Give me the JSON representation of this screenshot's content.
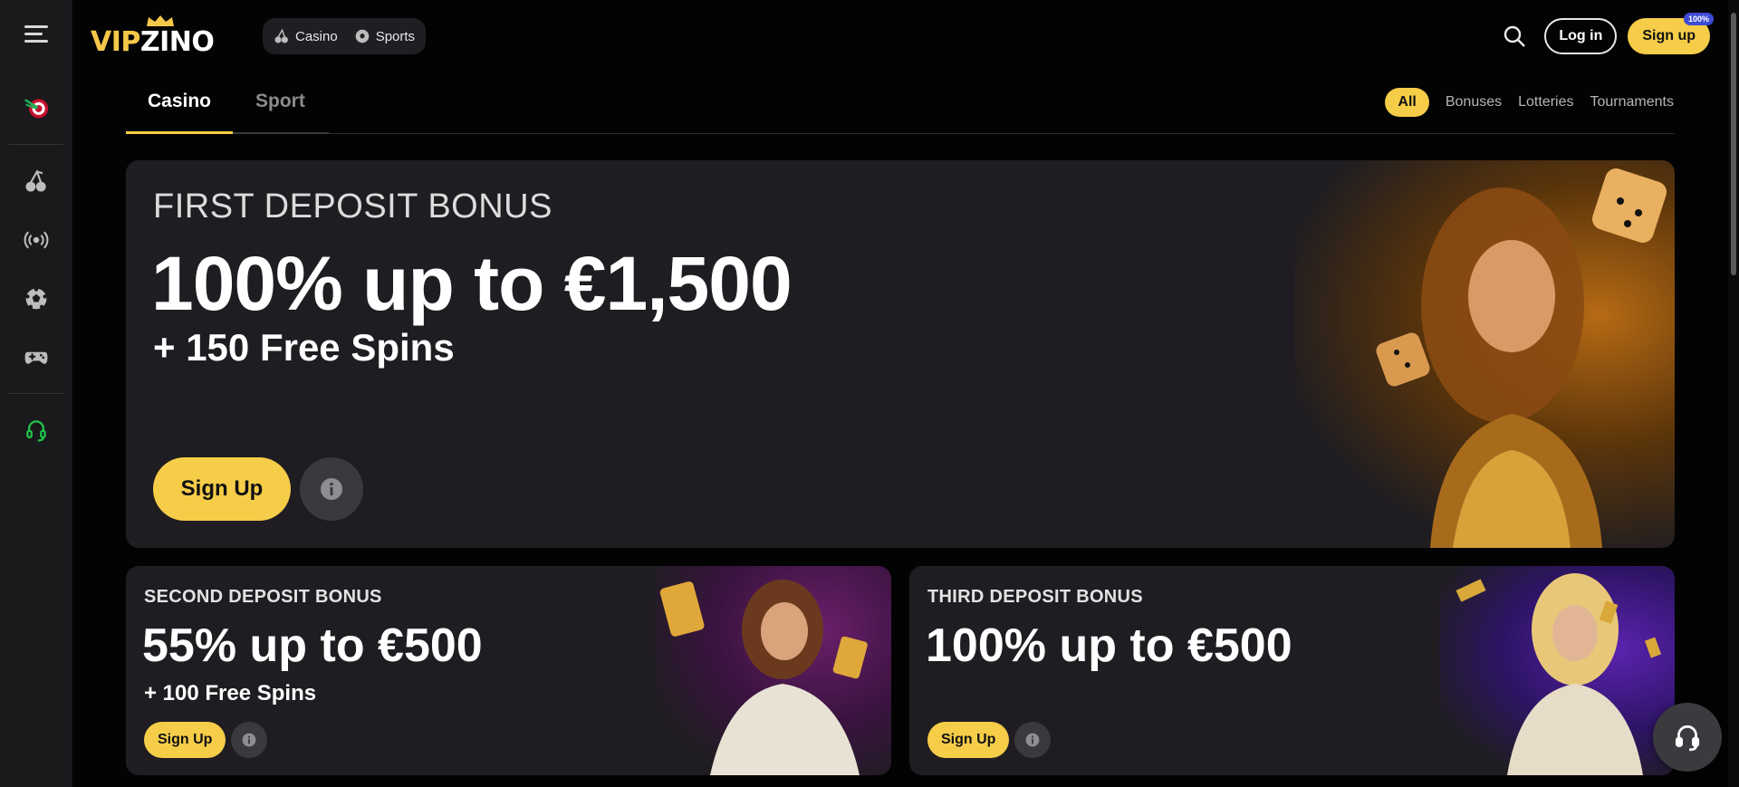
{
  "brand": {
    "logo_left": "VIP",
    "logo_right": "ZINO",
    "accent": "#f6cd48",
    "bg": "#030303",
    "card_bg": "#1f1d21"
  },
  "rail": {
    "items": [
      {
        "icon": "menu-icon"
      },
      {
        "icon": "target-darts-icon"
      },
      {
        "icon": "cherry-icon"
      },
      {
        "icon": "live-broadcast-icon"
      },
      {
        "icon": "soccer-ball-icon"
      },
      {
        "icon": "gamepad-icon"
      },
      {
        "icon": "headset-icon"
      }
    ]
  },
  "topnav": {
    "casino": "Casino",
    "sports": "Sports"
  },
  "header": {
    "login": "Log in",
    "signup": "Sign up",
    "badge": "100%"
  },
  "tabs": {
    "casino": "Casino",
    "sport": "Sport"
  },
  "filters": {
    "all": "All",
    "bonuses": "Bonuses",
    "lotteries": "Lotteries",
    "tournaments": "Tournaments"
  },
  "hero": {
    "eyebrow": "FIRST DEPOSIT BONUS",
    "headline": "100% up to €1,500",
    "sub": "+ 150 Free Spins",
    "cta": "Sign Up"
  },
  "cards": [
    {
      "eyebrow": "SECOND DEPOSIT BONUS",
      "headline": "55% up to €500",
      "sub": "+ 100 Free Spins",
      "cta": "Sign Up"
    },
    {
      "eyebrow": "THIRD DEPOSIT BONUS",
      "headline": "100% up to €500",
      "cta": "Sign Up"
    }
  ]
}
